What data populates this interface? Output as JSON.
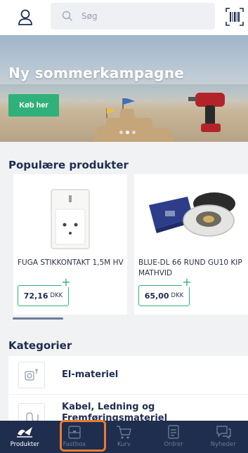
{
  "header": {
    "search_placeholder": "Søg",
    "profile_icon": "person-icon",
    "barcode_icon": "barcode-icon"
  },
  "hero": {
    "title": "Ny sommerkampagne",
    "cta_label": "Køb her",
    "pagination": {
      "total": 3,
      "active": 2
    }
  },
  "popular": {
    "title": "Populære produkter",
    "products": [
      {
        "name": "FUGA STIKKONTAKT 1,5M HV",
        "price": "72,16",
        "currency": "DKK"
      },
      {
        "name": "BLUE-DL 66 RUND GU10 KIP MATHVID",
        "price": "65,00",
        "currency": "DKK"
      }
    ]
  },
  "categories": {
    "title": "Kategorier",
    "items": [
      {
        "label": "El-materiel",
        "icon": "socket-icon"
      },
      {
        "label": "Kabel, Ledning og Fremføringsmateriel",
        "icon": "cable-icon"
      }
    ]
  },
  "tabbar": {
    "tabs": [
      {
        "label": "Produkter",
        "icon": "products-icon",
        "active": true
      },
      {
        "label": "Fastbox",
        "icon": "box-icon",
        "active": false
      },
      {
        "label": "Kurv",
        "icon": "cart-icon",
        "active": false
      },
      {
        "label": "Ordrer",
        "icon": "orders-icon",
        "active": false
      },
      {
        "label": "Nyheder",
        "icon": "news-icon",
        "active": false
      }
    ],
    "highlight_color": "#ea7a2d"
  },
  "colors": {
    "brand_navy": "#1f2d4e",
    "accent_green": "#30b07a"
  }
}
